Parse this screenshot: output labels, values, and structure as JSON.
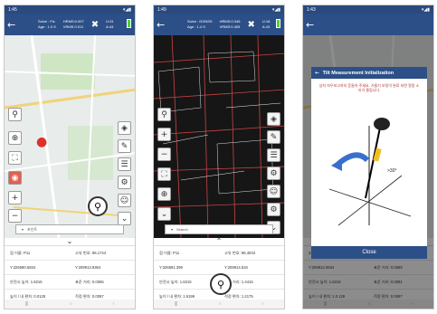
{
  "phone1": {
    "status_time": "1:45",
    "solve": "Solve : Fix",
    "solve_val": "HRMS:0.007",
    "age": "Age : 1.0 S",
    "age_val": "VRMS:0.011",
    "sats": "U:31",
    "sats2": "A:43",
    "search_placeholder": "포인트",
    "bottom": [
      [
        "점 이름: P11",
        "고유 번호: 96.1744"
      ],
      [
        "Y:326590.5834",
        "Y:209913.9364"
      ],
      [
        "안전시 높이: 1.8215",
        "표준 거리: 0.0065"
      ],
      [
        "높이 / 내 편차: 0.0128",
        "적정 편차: 0.0097"
      ]
    ]
  },
  "phone2": {
    "status_time": "1:49",
    "solve": "Solve : DGNSS",
    "solve_val": "HRMS:0.346",
    "age": "Age : 1.4 S",
    "age_val": "VRMS:0.405",
    "sats": "U:18",
    "sats2": "A:43",
    "search_placeholder": "Search",
    "bottom": [
      [
        "점 이름: P11",
        "고유 번호: 96.4034"
      ],
      [
        "Y:326591.399",
        "Y:209914.534"
      ],
      [
        "안전시 높이: 1.8215",
        "표준 거리: 1.4415"
      ],
      [
        "높이 / 내 편차: 1.6199",
        "적정 편차: 1.2175"
      ]
    ]
  },
  "phone3": {
    "status_time": "1:43",
    "dialog_title": "Tilt Measurement Initialization",
    "dialog_text": "상자 하우보고하지 흔들어 주세요. 기울기 보정이 완료 되면 알람 소리가 울립니다.",
    "angle_label": ">30°",
    "close_label": "Close",
    "bottom": [
      [
        "326590.5221",
        "Y:209813.9317"
      ],
      [
        "Y:209812.0834",
        "표준 거리: 0.0065"
      ],
      [
        "안전시 높이: 1.8215",
        "표준 거리: 0.0091"
      ],
      [
        "높이 / 내 편차: 1.0.128",
        "적정 편차: 0.0097"
      ]
    ]
  },
  "colors": {
    "header": "#2c4f87",
    "accent_red": "#e06050"
  }
}
